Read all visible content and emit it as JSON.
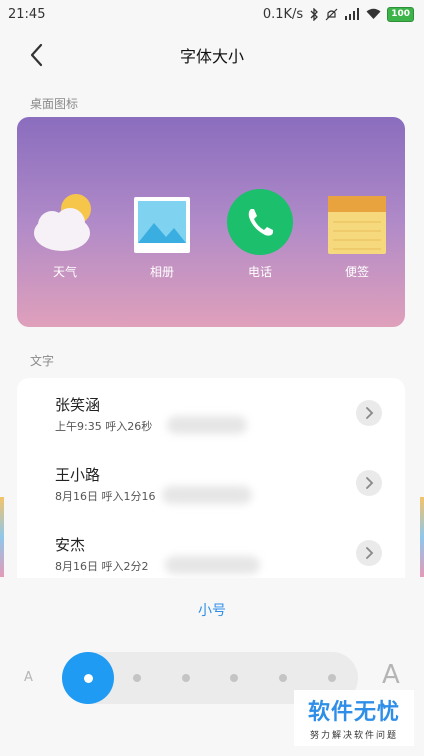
{
  "status_bar": {
    "time": "21:45",
    "network_speed": "0.1K/s",
    "battery": "100"
  },
  "header": {
    "title": "字体大小"
  },
  "desktop_icons": {
    "section_label": "桌面图标",
    "apps": [
      {
        "label": "天气",
        "icon": "weather-icon"
      },
      {
        "label": "相册",
        "icon": "gallery-icon"
      },
      {
        "label": "电话",
        "icon": "phone-icon"
      },
      {
        "label": "便签",
        "icon": "notes-icon"
      }
    ]
  },
  "text_preview": {
    "section_label": "文字",
    "rows": [
      {
        "name": "张笑涵",
        "detail": "上午9:35  呼入26秒"
      },
      {
        "name": "王小路",
        "detail": "8月16日  呼入1分16"
      },
      {
        "name": "安杰",
        "detail": "8月16日  呼入2分2"
      }
    ]
  },
  "font_size": {
    "current_label": "小号",
    "small_marker": "A",
    "large_marker": "A",
    "levels": 6,
    "selected_level": 1
  },
  "watermark": {
    "title": "软件无忧",
    "subtitle": "努力解决软件问题"
  },
  "colors": {
    "accent": "#1f9bf3",
    "phone_green": "#1cbf6b",
    "card_gradient_top": "#8a6dbe",
    "card_gradient_bottom": "#dfa0bb"
  }
}
